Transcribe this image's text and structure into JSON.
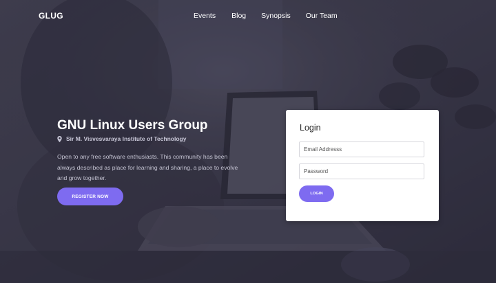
{
  "brand": "GLUG",
  "nav": {
    "items": [
      "Events",
      "Blog",
      "Synopsis",
      "Our Team"
    ]
  },
  "hero": {
    "title": "GNU Linux Users Group",
    "location": "Sir M. Visvesvaraya Institute of Technology",
    "location_icon": "map-pin-icon",
    "description": "Open to any free software enthusiasts. This community has been always described as place for learning and sharing, a place to evolve and grow together.",
    "register_label": "REGISTER NOW"
  },
  "login": {
    "title": "Login",
    "email_placeholder": "Email Addresss",
    "password_placeholder": "Password",
    "button_label": "LOGIN"
  },
  "colors": {
    "accent": "#7e6bf0",
    "overlay": "#3d3c4c",
    "card": "#ffffff"
  }
}
